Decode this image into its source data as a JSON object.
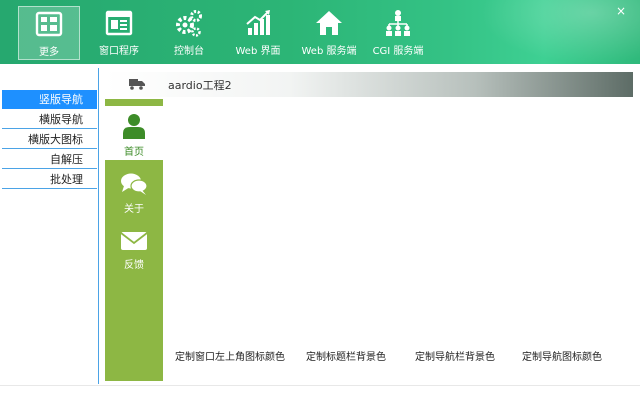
{
  "toolbar": {
    "close": "×",
    "buttons": [
      {
        "label": "更多",
        "icon": "grid-icon"
      },
      {
        "label": "窗口程序",
        "icon": "window-icon"
      },
      {
        "label": "控制台",
        "icon": "gears-icon"
      },
      {
        "label": "Web 界面",
        "icon": "bar-chart-icon"
      },
      {
        "label": "Web 服务端",
        "icon": "home-icon"
      },
      {
        "label": "CGI 服务端",
        "icon": "network-icon"
      }
    ]
  },
  "leftnav": {
    "items": [
      {
        "label": "竖版导航",
        "active": true
      },
      {
        "label": "横版导航"
      },
      {
        "label": "横版大图标"
      },
      {
        "label": "自解压"
      },
      {
        "label": "批处理"
      }
    ]
  },
  "tab": {
    "label": "aardio工程2",
    "icon": "truck-icon"
  },
  "sidebar": {
    "items": [
      {
        "label": "首页",
        "icon": "user-icon",
        "active": true
      },
      {
        "label": "关于",
        "icon": "chat-icon"
      },
      {
        "label": "反馈",
        "icon": "mail-icon"
      }
    ]
  },
  "content": {
    "labels": [
      "定制窗口左上角图标颜色",
      "定制标题栏背景色",
      "定制导航栏背景色",
      "定制导航图标颜色"
    ]
  },
  "colors": {
    "toolbar_green": "#2cb576",
    "sidebar_green": "#8db744",
    "nav_active": "#1e90ff",
    "nav_line": "#4ba3e6"
  }
}
